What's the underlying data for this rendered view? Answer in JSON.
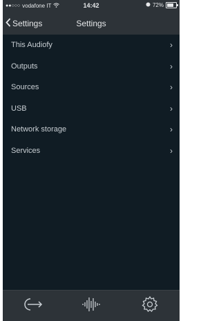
{
  "status": {
    "carrier": "vodafone IT",
    "time": "14:42",
    "battery_text": "72%",
    "battery_level": 0.72
  },
  "nav": {
    "back_label": "Settings",
    "title": "Settings"
  },
  "menu": {
    "items": [
      {
        "label": "This Audiofy"
      },
      {
        "label": "Outputs"
      },
      {
        "label": "Sources"
      },
      {
        "label": "USB"
      },
      {
        "label": "Network storage"
      },
      {
        "label": "Services"
      }
    ]
  },
  "tabbar": {
    "tabs": [
      {
        "icon": "login-arrow-icon"
      },
      {
        "icon": "waveform-icon"
      },
      {
        "icon": "gear-icon"
      }
    ]
  }
}
